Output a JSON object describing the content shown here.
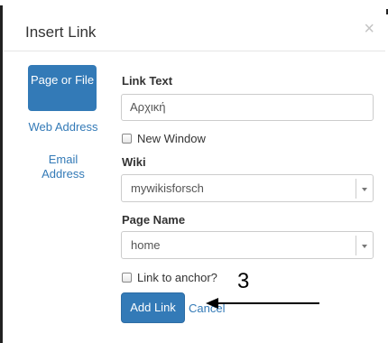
{
  "dialog": {
    "title": "Insert Link",
    "close_glyph": "×"
  },
  "nav": {
    "items": [
      {
        "label": "Page or File",
        "active": true
      },
      {
        "label": "Web Address",
        "active": false
      },
      {
        "label": "Email Address",
        "active": false
      }
    ]
  },
  "form": {
    "link_text_label": "Link Text",
    "link_text_value": "Αρχική",
    "new_window_label": "New Window",
    "new_window_checked": false,
    "wiki_label": "Wiki",
    "wiki_selected": "mywikisforsch",
    "page_name_label": "Page Name",
    "page_name_selected": "home",
    "anchor_label": "Link to anchor?",
    "anchor_checked": false
  },
  "actions": {
    "add_label": "Add Link",
    "cancel_label": "Cancel"
  },
  "annotation": {
    "step_number": "3"
  },
  "colors": {
    "primary": "#337ab7",
    "border": "#cccccc",
    "close": "#c4c4c4"
  },
  "icons": {
    "close": "close-icon",
    "select_arrow": "chevron-down-icon"
  }
}
